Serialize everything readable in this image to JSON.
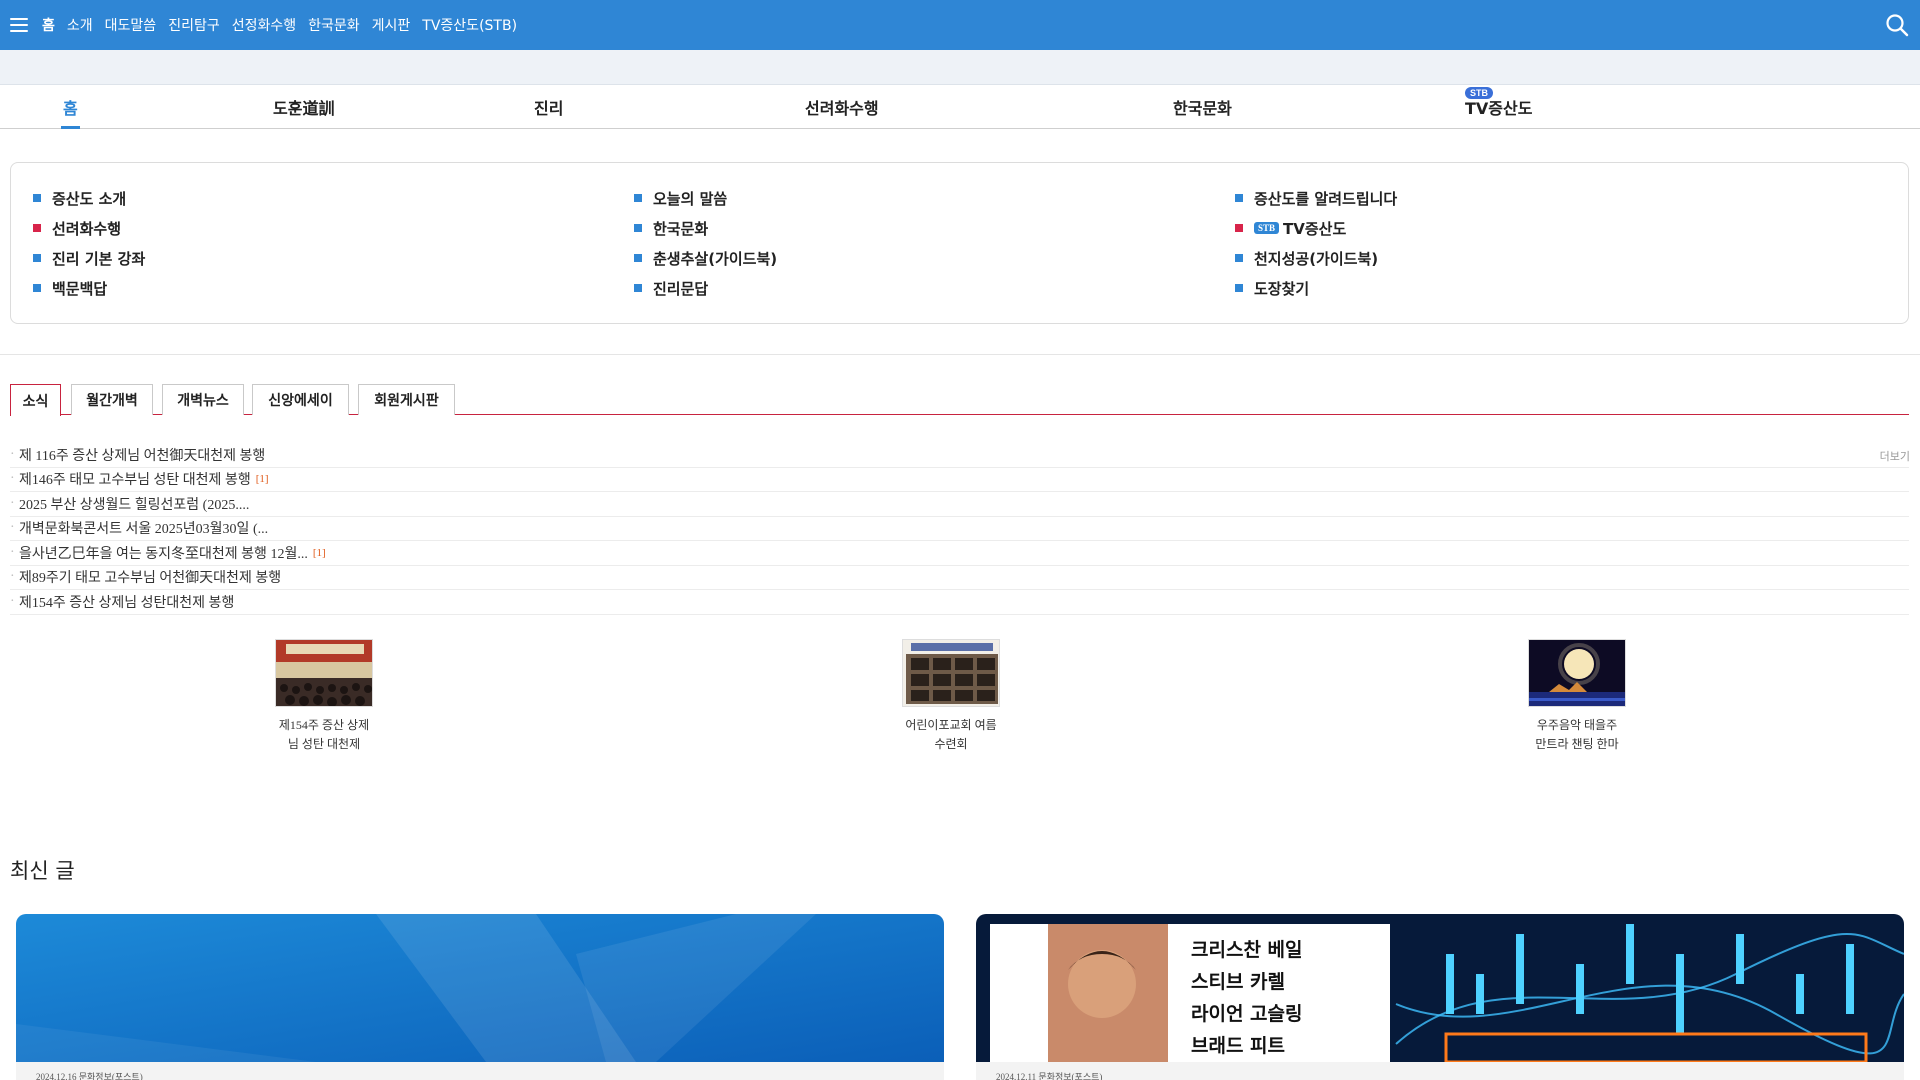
{
  "topnav": {
    "items": [
      "홈",
      "소개",
      "대도말씀",
      "진리탐구",
      "선정화수행",
      "한국문화",
      "게시판",
      "TV증산도(STB)"
    ]
  },
  "maintabs": {
    "items": [
      "홈",
      "도훈道訓",
      "진리",
      "선려화수행",
      "한국문화",
      "TV증산도"
    ],
    "badge": "STB"
  },
  "quicklinks": {
    "col1": [
      "증산도 소개",
      "선려화수행",
      "진리 기본 강좌",
      "백문백답"
    ],
    "col2": [
      "오늘의 말씀",
      "한국문화",
      "춘생추살(가이드북)",
      "진리문답"
    ],
    "col3": [
      "증산도를 알려드립니다",
      "TV증산도",
      "천지성공(가이드북)",
      "도장찾기"
    ],
    "stb_mini": "STB"
  },
  "boardtabs": [
    "소식",
    "월간개벽",
    "개벽뉴스",
    "신앙에세이",
    "회원게시판"
  ],
  "posts": [
    {
      "title": "제 116주 증산 상제님 어천御天대천제 봉행",
      "count": ""
    },
    {
      "title": "제146주 태모 고수부님 성탄 대천제 봉행",
      "count": "[1]"
    },
    {
      "title": "2025 부산 상생월드 힐링선포럼 (2025....",
      "count": ""
    },
    {
      "title": "개벽문화북콘서트 서울 2025년03월30일 (...",
      "count": ""
    },
    {
      "title": "을사년乙巳年을 여는 동지冬至대천제 봉행 12월...",
      "count": "[1]"
    },
    {
      "title": "제89주기 태모 고수부님 어천御天대천제 봉행",
      "count": ""
    },
    {
      "title": "제154주 증산 상제님 성탄대천제 봉행",
      "count": ""
    }
  ],
  "more_label": "더보기",
  "thumbs": [
    {
      "line1": "제154주 증산 상제",
      "line2": "님 성탄 대천제"
    },
    {
      "line1": "어린이포교회 여름",
      "line2": "수련회"
    },
    {
      "line1": "우주음악 태을주",
      "line2": "만트라 챈팅 한마"
    }
  ],
  "latest": {
    "title": "최신 글",
    "cards": [
      {
        "meta": "2024.12.16  문화정보(포스트)"
      },
      {
        "meta": "2024.12.11  문화정보(포스트)"
      }
    ],
    "poster_text": [
      "크리스찬 베일",
      "스티브 카렐",
      "라이언 고슬링",
      "브래드 피트"
    ]
  },
  "colors": {
    "accent": "#2f86d5",
    "red": "#c8233f",
    "bullet_red": "#d8244a"
  }
}
